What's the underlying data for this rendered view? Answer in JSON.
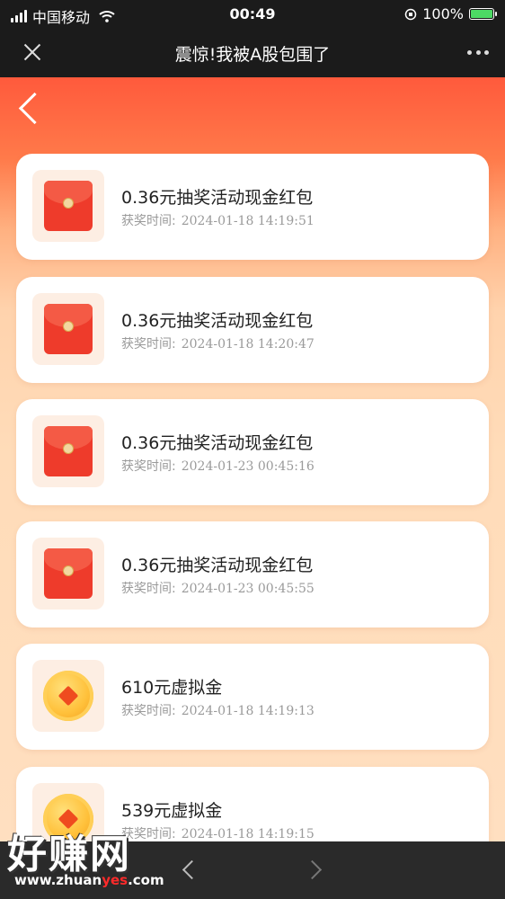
{
  "status_bar": {
    "carrier": "中国移动",
    "time": "00:49",
    "battery_percent": "100%",
    "battery_level": 1.0
  },
  "nav": {
    "title": "震惊!我被A股包围了"
  },
  "records": [
    {
      "title": "0.36元抽奖活动现金红包",
      "time_label": "获奖时间:",
      "time": "2024-01-18 14:19:51",
      "icon": "red-envelope-icon"
    },
    {
      "title": "0.36元抽奖活动现金红包",
      "time_label": "获奖时间:",
      "time": "2024-01-18 14:20:47",
      "icon": "red-envelope-icon"
    },
    {
      "title": "0.36元抽奖活动现金红包",
      "time_label": "获奖时间:",
      "time": "2024-01-23 00:45:16",
      "icon": "red-envelope-icon"
    },
    {
      "title": "0.36元抽奖活动现金红包",
      "time_label": "获奖时间:",
      "time": "2024-01-23 00:45:55",
      "icon": "red-envelope-icon"
    },
    {
      "title": "610元虚拟金",
      "time_label": "获奖时间:",
      "time": "2024-01-18 14:19:13",
      "icon": "gold-coin-icon"
    },
    {
      "title": "539元虚拟金",
      "time_label": "获奖时间:",
      "time": "2024-01-18 14:19:15",
      "icon": "gold-coin-icon"
    }
  ],
  "watermark": {
    "main": "好赚网",
    "url_prefix": "www.zhuan",
    "url_highlight": "yes",
    "url_suffix": ".com"
  },
  "colors": {
    "header_bg": "#1b1b1b",
    "banner_red": "#ff5a3c",
    "page_peach": "#ffdfc0",
    "envelope_red": "#ee3b2b",
    "coin_gold": "#ffc13b",
    "watermark_red": "#ff2a2a"
  }
}
